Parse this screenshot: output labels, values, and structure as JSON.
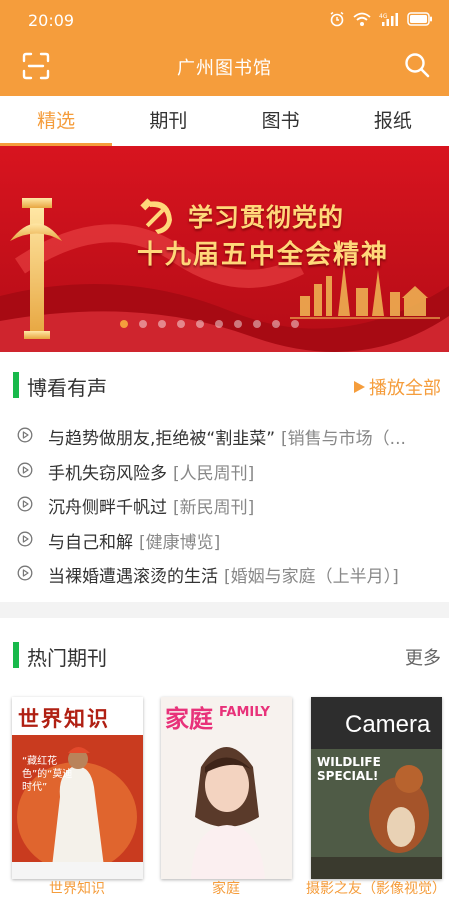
{
  "status": {
    "time": "20:09"
  },
  "app": {
    "title": "广州图书馆"
  },
  "tabs": [
    {
      "label": "精选",
      "active": true
    },
    {
      "label": "期刊",
      "active": false
    },
    {
      "label": "图书",
      "active": false
    },
    {
      "label": "报纸",
      "active": false
    }
  ],
  "banner": {
    "line1": "学习贯彻党的",
    "line2": "十九届五中全会精神",
    "slide_count": 10,
    "active_slide": 1
  },
  "audio": {
    "title": "博看有声",
    "play_all": "播放全部",
    "items": [
      {
        "title": "与趋势做朋友,拒绝被“割韭菜”",
        "source": "[销售与市场（..."
      },
      {
        "title": "手机失窃风险多",
        "source": "[人民周刊]"
      },
      {
        "title": "沉舟侧畔千帆过",
        "source": "[新民周刊]"
      },
      {
        "title": "与自己和解",
        "source": "[健康博览]"
      },
      {
        "title": "当裸婚遭遇滚烫的生活",
        "source": "[婚姻与家庭（上半月）]"
      }
    ]
  },
  "hot": {
    "title": "热门期刊",
    "more": "更多",
    "magazines": [
      {
        "name": "世界知识",
        "cover_title": "世界知识",
        "cover_text": "“藏红花色”的“莫迪时代”",
        "color": "#d63a20"
      },
      {
        "name": "家庭",
        "cover_title": "家庭",
        "cover_sub": "FAMILY",
        "color": "#e8327a"
      },
      {
        "name": "摄影之友（影像视觉）",
        "cover_title": "Camera",
        "cover_text": "WILDLIFE SPECIAL!",
        "color": "#3a4a3a"
      }
    ]
  },
  "colors": {
    "accent": "#f59d3c",
    "section_bar": "#18b94b",
    "banner_red": "#c8111b"
  }
}
